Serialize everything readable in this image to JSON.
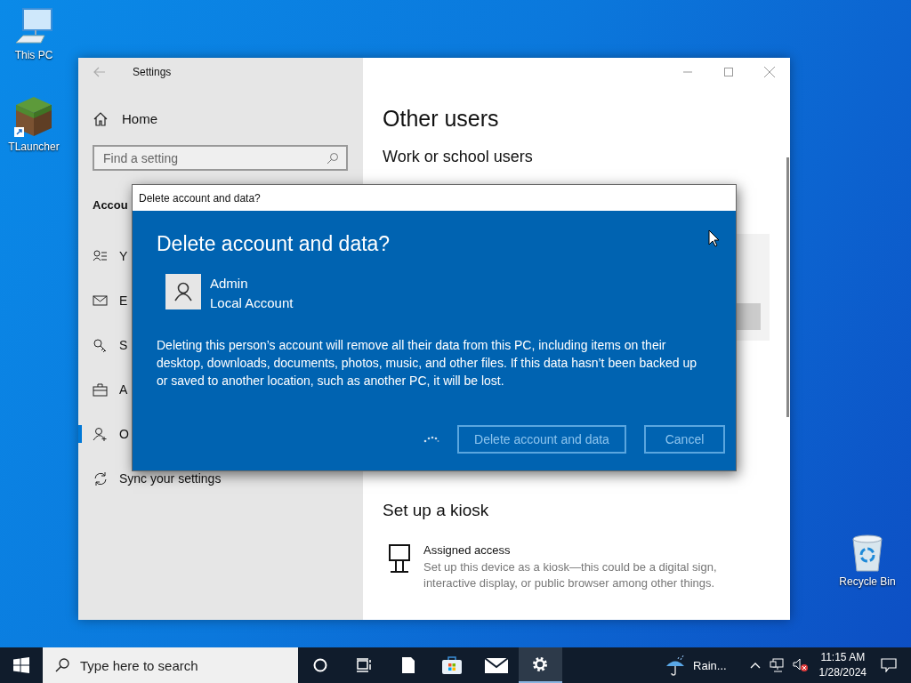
{
  "desktop_icons": [
    {
      "label": "This PC",
      "kind": "computer"
    },
    {
      "label": "TLauncher",
      "kind": "block"
    },
    {
      "label": "Recycle Bin",
      "kind": "bin"
    }
  ],
  "settings": {
    "title": "Settings",
    "home": "Home",
    "search": {
      "placeholder": "Find a setting"
    },
    "section": "Accou",
    "nav": [
      {
        "label": "Y",
        "kind": "info",
        "selected": false
      },
      {
        "label": "E",
        "kind": "mail",
        "selected": false
      },
      {
        "label": "S",
        "kind": "key",
        "selected": false
      },
      {
        "label": "A",
        "kind": "briefcase",
        "selected": false
      },
      {
        "label": "O",
        "kind": "people",
        "selected": true
      },
      {
        "label": "Sync your settings",
        "kind": "sync",
        "selected": false
      }
    ],
    "heading": "Other users",
    "subheading": "Work or school users",
    "kiosk_heading": "Set up a kiosk",
    "kiosk_item": {
      "title": "Assigned access",
      "description": "Set up this device as a kiosk—this could be a digital sign, interactive display, or public browser among other things."
    }
  },
  "dialog": {
    "title": "Delete account and data?",
    "heading": "Delete account and data?",
    "user": {
      "name": "Admin",
      "type": "Local Account"
    },
    "message": "Deleting this person’s account will remove all their data from this PC, including items on their desktop, downloads, documents, photos, music, and other files. If this data hasn’t been backed up or saved to another location, such as another PC, it will be lost.",
    "busy": true,
    "buttons": [
      {
        "label": "Delete account and data",
        "disabled": true
      },
      {
        "label": "Cancel",
        "disabled": true
      }
    ]
  },
  "taskbar": {
    "search_placeholder": "Type here to search",
    "apps": [
      {
        "kind": "cortana",
        "selected": false
      },
      {
        "kind": "taskview",
        "selected": false
      },
      {
        "kind": "file",
        "selected": false
      },
      {
        "kind": "store",
        "selected": false
      },
      {
        "kind": "mail",
        "selected": false
      },
      {
        "kind": "settings",
        "selected": true
      }
    ],
    "weather": "Rain...",
    "time": "11:15 AM",
    "date": "1/28/2024"
  }
}
